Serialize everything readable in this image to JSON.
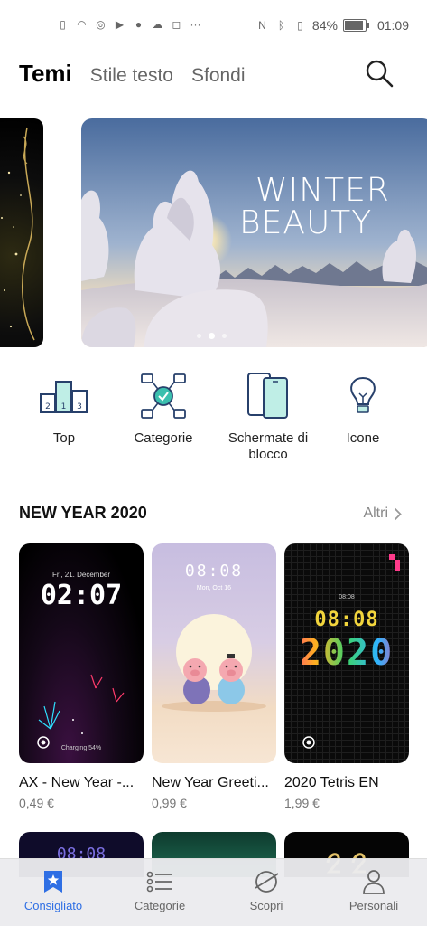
{
  "status_bar": {
    "battery_percent_text": "84%",
    "battery_level": 0.84,
    "time": "01:09",
    "more_indicator": "···"
  },
  "header": {
    "tabs": [
      {
        "label": "Temi",
        "active": true
      },
      {
        "label": "Stile testo",
        "active": false
      },
      {
        "label": "Sfondi",
        "active": false
      }
    ]
  },
  "banner": {
    "title_line1": "WINTER",
    "title_line2": "BEAUTY",
    "page_count": 3,
    "active_page": 2
  },
  "categories": [
    {
      "label": "Top",
      "icon": "podium-icon"
    },
    {
      "label": "Categorie",
      "icon": "categories-icon"
    },
    {
      "label": "Schermate di blocco",
      "icon": "lockscreen-icon"
    },
    {
      "label": "Icone",
      "icon": "lightbulb-icon"
    }
  ],
  "section": {
    "title": "NEW YEAR 2020",
    "more_label": "Altri"
  },
  "themes": [
    {
      "name": "AX - New Year -...",
      "price": "0,49 €",
      "preview": {
        "date": "Fri, 21. December",
        "time": "02:07",
        "charging": "Charging 54%"
      }
    },
    {
      "name": "New Year Greeti...",
      "price": "0,99 €",
      "preview": {
        "time": "08:08",
        "date": "Mon, Oct 16"
      }
    },
    {
      "name": "2020 Tetris EN",
      "price": "1,99 €",
      "preview": {
        "time": "08:08",
        "year": "2020"
      }
    }
  ],
  "bottom_nav": [
    {
      "label": "Consigliato",
      "icon": "star-bookmark-icon",
      "active": true
    },
    {
      "label": "Categorie",
      "icon": "list-icon",
      "active": false
    },
    {
      "label": "Scopri",
      "icon": "planet-icon",
      "active": false
    },
    {
      "label": "Personali",
      "icon": "person-icon",
      "active": false
    }
  ],
  "colors": {
    "accent": "#2f6fe4",
    "category_icon_teal": "#3bbfae",
    "category_icon_navy": "#27406b"
  }
}
